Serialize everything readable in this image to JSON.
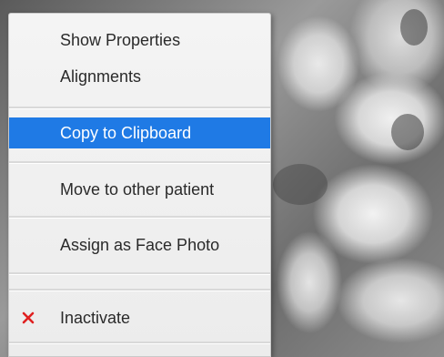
{
  "context_menu": {
    "items": [
      {
        "label": "Show Properties"
      },
      {
        "label": "Alignments"
      },
      {
        "label": "Copy to Clipboard",
        "selected": true
      },
      {
        "label": "Move to other patient"
      },
      {
        "label": "Assign as Face Photo"
      },
      {
        "label": "Inactivate",
        "icon": "close-icon",
        "icon_color": "#e02020"
      }
    ],
    "selection_color": "#1f7ae5"
  }
}
